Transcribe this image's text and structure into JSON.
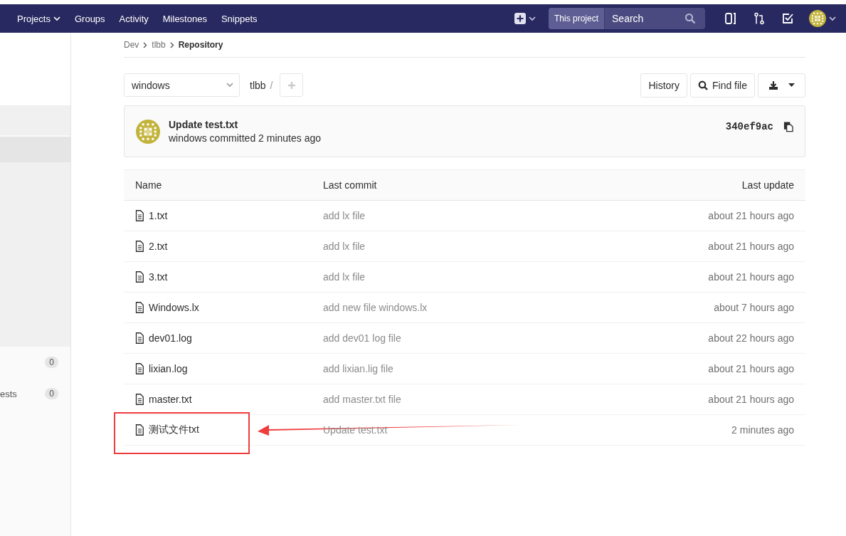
{
  "nav": {
    "items": [
      {
        "label": "Projects",
        "dropdown": true
      },
      {
        "label": "Groups",
        "dropdown": false
      },
      {
        "label": "Activity",
        "dropdown": false
      },
      {
        "label": "Milestones",
        "dropdown": false
      },
      {
        "label": "Snippets",
        "dropdown": false
      }
    ],
    "search": {
      "scope": "This project",
      "placeholder": "Search"
    }
  },
  "sidebar": {
    "items": [
      {
        "count": "0"
      },
      {
        "label": "ests",
        "count": "0"
      }
    ]
  },
  "breadcrumb": [
    "Dev",
    "tlbb",
    "Repository"
  ],
  "branch": "windows",
  "path": "tlbb",
  "path_sep": "/",
  "actions": {
    "history": "History",
    "find": "Find file"
  },
  "commit": {
    "title": "Update test.txt",
    "author": "windows",
    "meta": "committed 2 minutes ago",
    "sha": "340ef9ac"
  },
  "table": {
    "columns": [
      "Name",
      "Last commit",
      "Last update"
    ],
    "rows": [
      {
        "name": "1.txt",
        "commit": "add lx file",
        "updated": "about 21 hours ago",
        "highlighted": false
      },
      {
        "name": "2.txt",
        "commit": "add lx file",
        "updated": "about 21 hours ago",
        "highlighted": false
      },
      {
        "name": "3.txt",
        "commit": "add lx file",
        "updated": "about 21 hours ago",
        "highlighted": false
      },
      {
        "name": "Windows.lx",
        "commit": "add new file windows.lx",
        "updated": "about 7 hours ago",
        "highlighted": false
      },
      {
        "name": "dev01.log",
        "commit": "add dev01 log file",
        "updated": "about 22 hours ago",
        "highlighted": false
      },
      {
        "name": "lixian.log",
        "commit": "add lixian.lig file",
        "updated": "about 21 hours ago",
        "highlighted": false
      },
      {
        "name": "master.txt",
        "commit": "add master.txt file",
        "updated": "about 21 hours ago",
        "highlighted": false
      },
      {
        "name": "测试文件txt",
        "commit": "Update test.txt",
        "updated": "2 minutes ago",
        "highlighted": true
      }
    ]
  }
}
